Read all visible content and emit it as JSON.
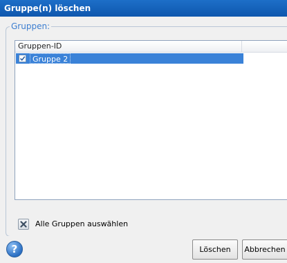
{
  "dialog": {
    "title": "Gruppe(n) löschen",
    "group_label": "Gruppen:"
  },
  "list": {
    "column_header": "Gruppen-ID",
    "rows": [
      {
        "label": "Gruppe 2",
        "checked": true,
        "selected": true
      }
    ]
  },
  "select_all": {
    "label": "Alle Gruppen auswählen",
    "icon": "x-icon"
  },
  "footer": {
    "help_icon": "question-icon",
    "help_glyph": "?",
    "delete_label": "Löschen",
    "cancel_label": "Abbrechen"
  },
  "colors": {
    "title_bar": "#0e57ad",
    "selection": "#3a82d8",
    "group_label": "#3c7ed0"
  }
}
